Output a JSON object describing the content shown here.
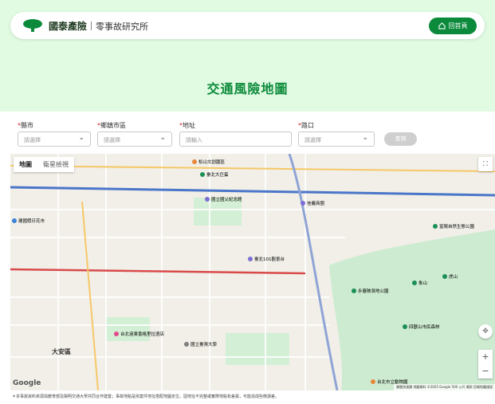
{
  "header": {
    "brand": "國泰產險",
    "sub": "零事故研究所",
    "home_label": "回首頁"
  },
  "page_title": "交通風險地圖",
  "filters": [
    {
      "label": "縣市",
      "value": "請選擇"
    },
    {
      "label": "鄉鎮市區",
      "value": "請選擇"
    },
    {
      "label": "地址",
      "placeholder": "請輸入"
    },
    {
      "label": "路口",
      "value": "請選擇"
    }
  ],
  "query_label": "查詢",
  "map": {
    "tabs": [
      "地圖",
      "衛星檢視"
    ],
    "logo": "Google",
    "attribution": "鍵盤快速鍵  地圖資料 ©2025 Google  500 公尺  條款  回報地圖錯誤",
    "districts": [
      "大安區"
    ],
    "pois": [
      {
        "name": "松山文創園區",
        "color": "#e8883a"
      },
      {
        "name": "國立國父紀念館",
        "color": "#7b6fd3"
      },
      {
        "name": "臺北大巨蛋",
        "color": "#1c8f56"
      },
      {
        "name": "信義商圈",
        "color": "#7b6fd3"
      },
      {
        "name": "臺北101觀景台",
        "color": "#7b6fd3"
      },
      {
        "name": "台北遠東香格里拉酒店",
        "color": "#e04a8b"
      },
      {
        "name": "國立臺灣大學",
        "color": "#7f7f7f"
      },
      {
        "name": "象山",
        "color": "#1c8f56"
      },
      {
        "name": "虎山",
        "color": "#1c8f56"
      },
      {
        "name": "永春陂濕地公園",
        "color": "#1c8f56"
      },
      {
        "name": "富陽自然生態公園",
        "color": "#1c8f56"
      },
      {
        "name": "四獸山市民森林",
        "color": "#1c8f56"
      },
      {
        "name": "台北市立動物園",
        "color": "#e8883a"
      },
      {
        "name": "建國假日花市",
        "color": "#3b83d9"
      }
    ]
  },
  "footnote": "＊本事故資料來源與教育部及陽明交通大學共同合作建置；事故地點是依案件地址搭配地圖定位，因地址不完整或實際地點有差異，可能造成些微誤差。"
}
